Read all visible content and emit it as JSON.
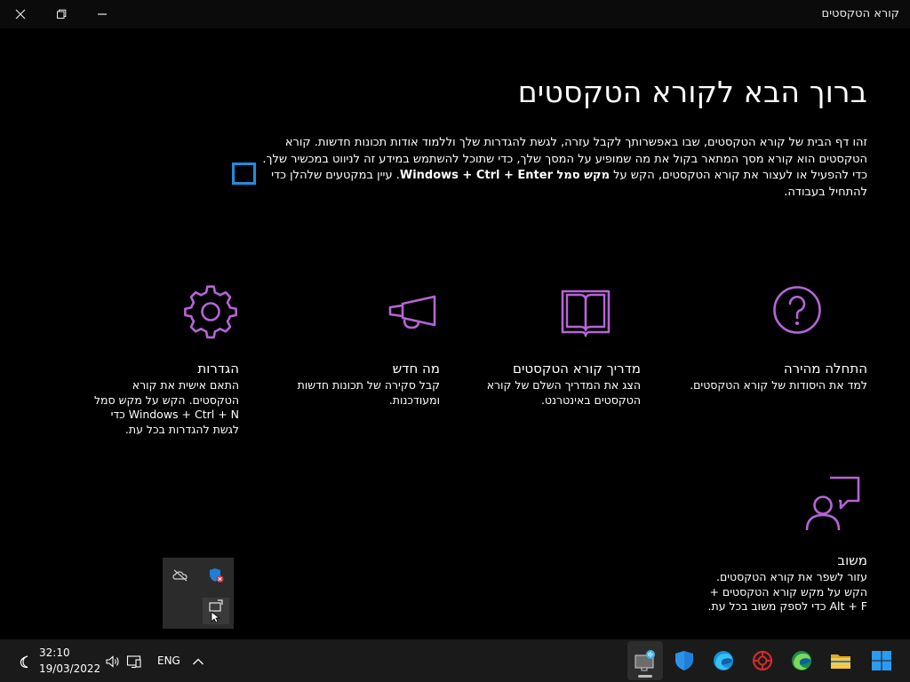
{
  "window": {
    "title": "קורא הטקסטים"
  },
  "main": {
    "heading": "ברוך הבא לקורא הטקסטים",
    "intro": {
      "part1": "זהו דף הבית של קורא הטקסטים, שבו באפשרותך לקבל עזרה, לגשת להגדרות שלך וללמוד אודות תכונות חדשות. קורא הטקסטים הוא קורא מסך המתאר בקול את מה שמופיע על המסך שלך, כדי שתוכל להשתמש במידע זה לניווט במכשיר שלך. כדי להפעיל או לעצור את קורא הטקסטים, הקש על ",
      "bold1": "מקש סמל Windows + Ctrl + Enter",
      "part2": ". עיין במקטעים שלהלן כדי להתחיל בעבודה."
    },
    "cards": [
      {
        "id": "quickstart",
        "icon": "question-circle-icon",
        "title": "התחלה מהירה",
        "desc": "למד את היסודות של קורא הטקסטים."
      },
      {
        "id": "guide",
        "icon": "book-icon",
        "title": "מדריך קורא הטקסטים",
        "desc": "הצג את המדריך השלם של קורא הטקסטים באינטרנט."
      },
      {
        "id": "whatsnew",
        "icon": "megaphone-icon",
        "title": "מה חדש",
        "desc": "קבל סקירה של תכונות חדשות ומעודכנות."
      },
      {
        "id": "settings",
        "icon": "gear-icon",
        "title": "הגדרות",
        "desc": "התאם אישית את קורא הטקסטים. הקש על מקש סמל Windows + Ctrl + N כדי לגשת להגדרות בכל עת."
      },
      {
        "id": "feedback",
        "icon": "feedback-person-icon",
        "title": "משוב",
        "desc": "עזור לשפר את קורא הטקסטים. הקש על מקש קורא הטקסטים + Alt + F כדי לספק משוב בכל עת."
      }
    ],
    "accent_color": "#b565d6"
  },
  "taskbar": {
    "time": "32:10",
    "date": "19/03/2022",
    "language": "ENG"
  }
}
